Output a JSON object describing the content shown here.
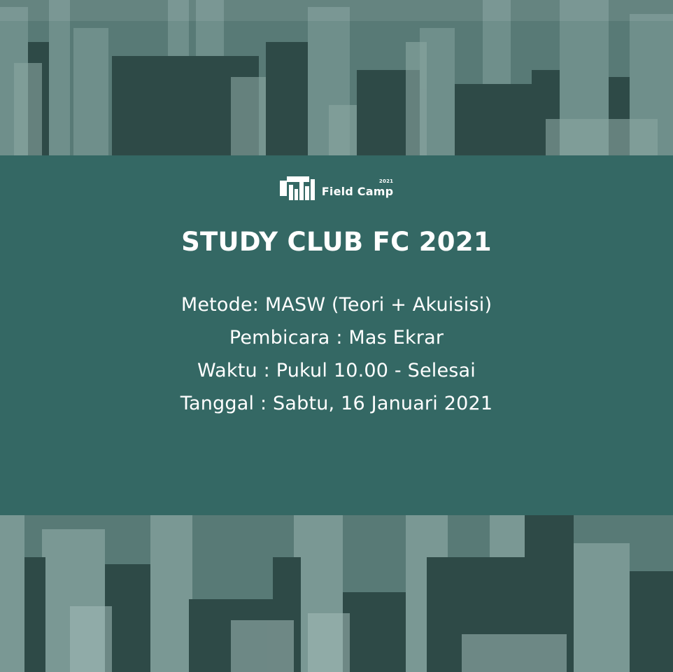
{
  "logo": {
    "text": "Field Camp",
    "year": "2021"
  },
  "title": "STUDY CLUB FC 2021",
  "details": [
    "Metode: MASW (Teori + Akuisisi)",
    "Pembicara : Mas Ekrar",
    "Waktu : Pukul 10.00 - Selesai",
    "Tanggal : Sabtu, 16 Januari 2021"
  ],
  "colors": {
    "band": "#346864",
    "text": "#ffffff",
    "city_tint": "#4d6f6b"
  },
  "background_image": "city-skyline-aerial-photo"
}
